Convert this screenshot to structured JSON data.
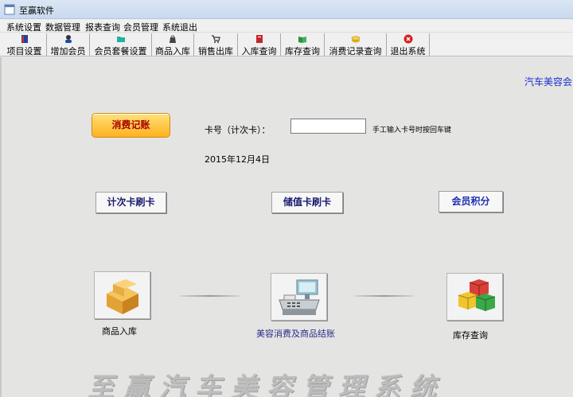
{
  "window": {
    "title": "至赢软件"
  },
  "menu": [
    "系统设置",
    "数据管理",
    "报表查询",
    "会员管理",
    "系统退出"
  ],
  "toolbar": [
    {
      "label": "项目设置",
      "icon": "book-icon"
    },
    {
      "label": "增加会员",
      "icon": "add-member-icon"
    },
    {
      "label": "会员套餐设置",
      "icon": "folder-icon"
    },
    {
      "label": "商品入库",
      "icon": "bag-icon"
    },
    {
      "label": "销售出库",
      "icon": "cart-icon"
    },
    {
      "label": "入库查询",
      "icon": "book-red-icon"
    },
    {
      "label": "库存查询",
      "icon": "open-book-icon"
    },
    {
      "label": "消费记录查询",
      "icon": "coins-icon"
    },
    {
      "label": "退出系统",
      "icon": "close-icon"
    }
  ],
  "main": {
    "marquee": "汽车美容会",
    "record_button": "消费记账",
    "card_label": "卡号（计次卡）：",
    "card_value": "",
    "card_hint": "手工输入卡号时按回车键",
    "date": "2015年12月4日",
    "count_card_button": "计次卡刷卡",
    "stored_card_button": "储值卡刷卡",
    "points_button": "会员积分",
    "tiles": {
      "stock_in": "商品入库",
      "checkout": "美容消费及商品结账",
      "inventory": "库存查询"
    },
    "brand": "至赢汽车美容管理系统"
  }
}
